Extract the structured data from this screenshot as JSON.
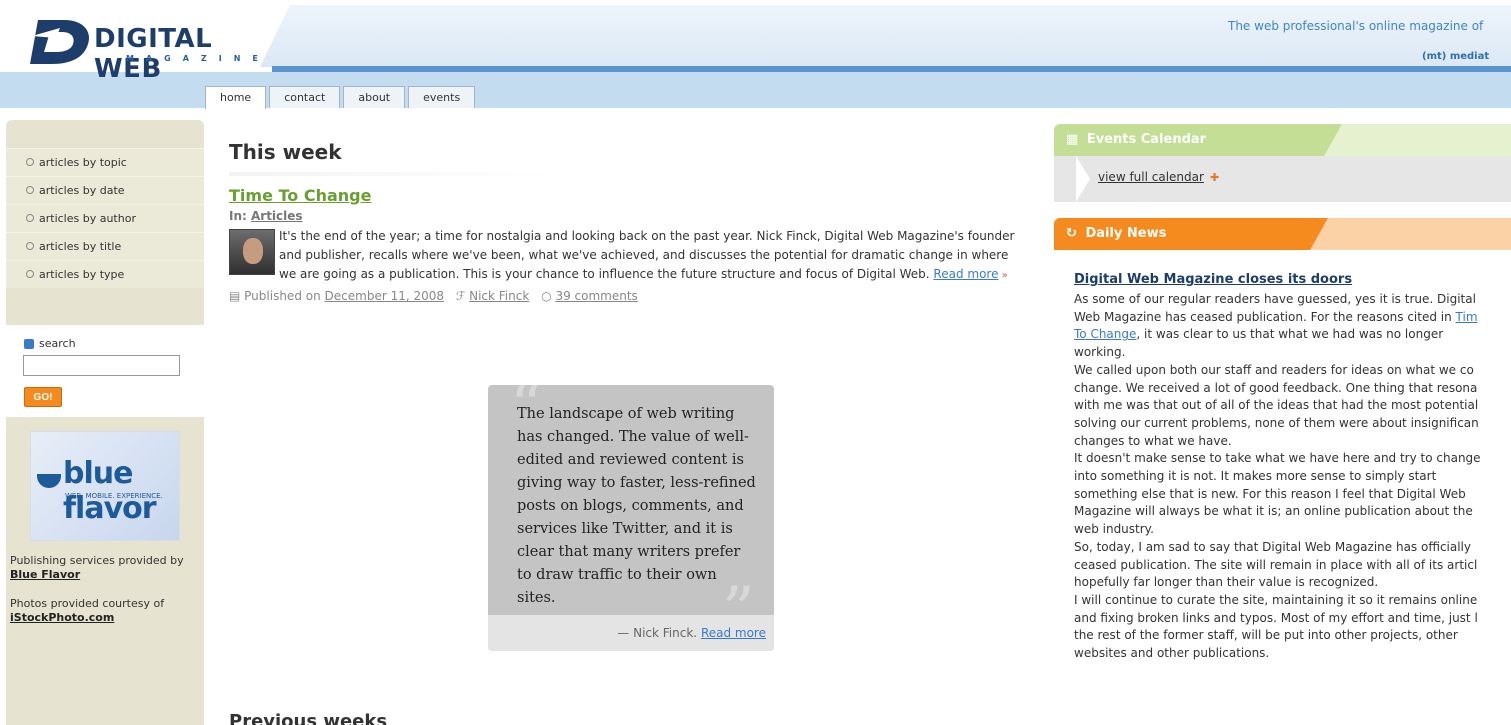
{
  "header": {
    "logo_word": "DIGITAL WEB",
    "logo_sub": "MAGAZINE",
    "tagline": "The web professional's online magazine of",
    "sponsor": "(mt) mediat"
  },
  "tabs": [
    {
      "label": "home"
    },
    {
      "label": "contact"
    },
    {
      "label": "about"
    },
    {
      "label": "events"
    }
  ],
  "sidebar": {
    "items": [
      {
        "label": "articles by topic"
      },
      {
        "label": "articles by date"
      },
      {
        "label": "articles by author"
      },
      {
        "label": "articles by title"
      },
      {
        "label": "articles by type"
      }
    ],
    "search_label": "search",
    "search_value": "",
    "go_label": "GO!",
    "sponsor_name": "blue flavor",
    "sponsor_tagline": "WEB. MOBILE. EXPERIENCE.",
    "credit1_text": "Publishing services provided by",
    "credit1_link": "Blue Flavor",
    "credit2_text": "Photos provided courtesy of",
    "credit2_link": "iStockPhoto.com"
  },
  "main": {
    "section_title": "This week",
    "article": {
      "title": "Time To Change",
      "category_prefix": "In: ",
      "category": "Articles",
      "body": "It's the end of the year; a time for nostalgia and looking back on the past year. Nick Finck, Digital Web Magazine's founder and publisher, recalls where we've been, what we've achieved, and discusses the potential for dramatic change in where we are going as a publication. This is your chance to influence the future structure and focus of Digital Web.",
      "read_more": "Read more",
      "published_prefix": "Published on",
      "published_date": "December 11, 2008",
      "author": "Nick Finck",
      "comments": "39 comments"
    },
    "quote": {
      "text": "The landscape of web writing has changed. The value of well-edited and reviewed content is giving way to faster, less-refined posts on blogs, comments, and services like Twitter, and it is clear that many writers prefer to draw traffic to their own sites.",
      "attribution": "— Nick Finck.",
      "read_more": "Read more"
    },
    "previous_title": "Previous weeks"
  },
  "right": {
    "events_title": "Events Calendar",
    "calendar_link": "view full calendar",
    "news_title": "Daily News",
    "news": {
      "headline": "Digital Web Magazine closes its doors",
      "lines": [
        "As some of our regular readers have guessed, yes it is true. Digital",
        "Web Magazine has ceased publication. For the reasons cited in ",
        "To Change",
        ", it was clear to us that what we had was no longer",
        "working.",
        "We called upon both our staff and readers for ideas on what we co",
        "change. We received a lot of good feedback. One thing that resona",
        "with me was that out of all of the ideas that had the most potential",
        "solving our current problems, none of them were about insignifican",
        "changes to what we have.",
        "It doesn't make sense to take what we have here and try to change",
        "into something it is not. It makes more sense to simply start",
        "something else that is new. For this reason I feel that Digital Web",
        "Magazine will always be what it is; an online publication about the",
        "web industry.",
        "So, today, I am sad to say that Digital Web Magazine has officially",
        "ceased publication. The site will remain in place with all of its articl",
        "hopefully far longer than their value is recognized.",
        "I will continue to curate the site, maintaining it so it remains online",
        "and fixing broken links and typos. Most of my effort and time, just l",
        "the rest of the former staff, will be put into other projects, other",
        "websites and other publications."
      ],
      "inline_link_prefix": "Tim"
    }
  },
  "colors": {
    "brand_blue": "#1d3d6b",
    "header_band": "#c4dcf0",
    "green_link": "#6a9f2f",
    "orange": "#f58a1f",
    "sidebar_bg": "#e6e3d0"
  }
}
